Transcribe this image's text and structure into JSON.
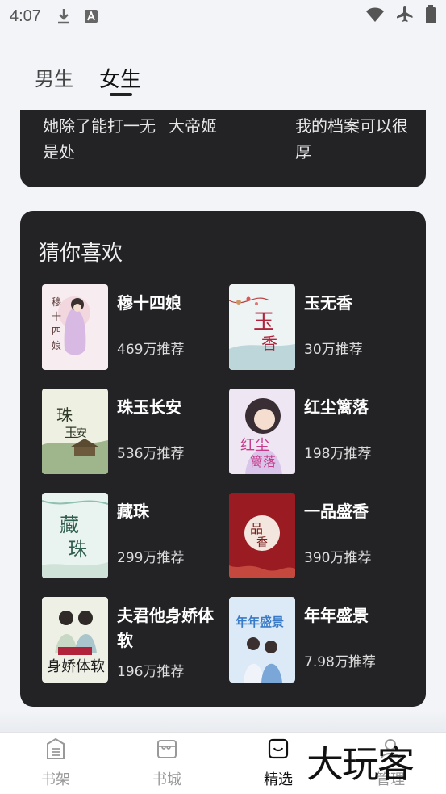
{
  "status_bar": {
    "time": "4:07"
  },
  "top_tabs": {
    "male": "男生",
    "female": "女生"
  },
  "top_card_items": [
    {
      "title": "她除了能打一无是处"
    },
    {
      "title": "大帝姬"
    },
    {
      "title": "我的档案可以很厚"
    }
  ],
  "recommend": {
    "title": "猜你喜欢",
    "books": [
      {
        "title": "穆十四娘",
        "count": "469万推荐",
        "cover_title": "穆十四娘"
      },
      {
        "title": "玉无香",
        "count": "30万推荐",
        "cover_title": "玉无香"
      },
      {
        "title": "珠玉长安",
        "count": "536万推荐",
        "cover_title": "珠玉长安"
      },
      {
        "title": "红尘篱落",
        "count": "198万推荐",
        "cover_title": "红尘篱落"
      },
      {
        "title": "藏珠",
        "count": "299万推荐",
        "cover_title": "藏珠"
      },
      {
        "title": "一品盛香",
        "count": "390万推荐",
        "cover_title": "一品盛香"
      },
      {
        "title": "夫君他身娇体软",
        "count": "196万推荐",
        "cover_title": "身娇体软"
      },
      {
        "title": "年年盛景",
        "count": "7.98万推荐",
        "cover_title": "年年盛景"
      }
    ]
  },
  "bottom_nav": {
    "shelf": "书架",
    "store": "书城",
    "featured": "精选",
    "manage": "管理"
  },
  "watermark": "大玩客"
}
